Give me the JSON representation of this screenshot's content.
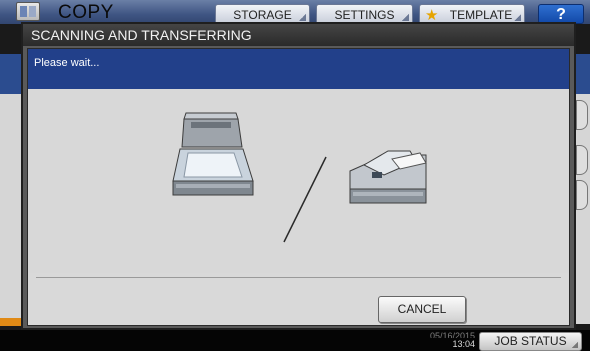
{
  "topbar": {
    "app_title": "COPY",
    "tabs": [
      {
        "label": "STORAGE"
      },
      {
        "label": "SETTINGS"
      },
      {
        "label": "TEMPLATE",
        "icon": "star-icon"
      }
    ],
    "help_label": "?"
  },
  "dialog": {
    "title": "SCANNING AND TRANSFERRING",
    "message": "Please wait...",
    "illustration": {
      "left": "flatbed-scanner-icon",
      "right": "document-feeder-icon"
    },
    "cancel_label": "CANCEL"
  },
  "statusbar": {
    "date_partial": "05/16/2015",
    "time": "13:04",
    "job_status_label": "JOB STATUS"
  },
  "colors": {
    "title_band": "#22408a",
    "dialog_frame": "#5a5a5a",
    "content_bg": "#d8d8d8"
  }
}
